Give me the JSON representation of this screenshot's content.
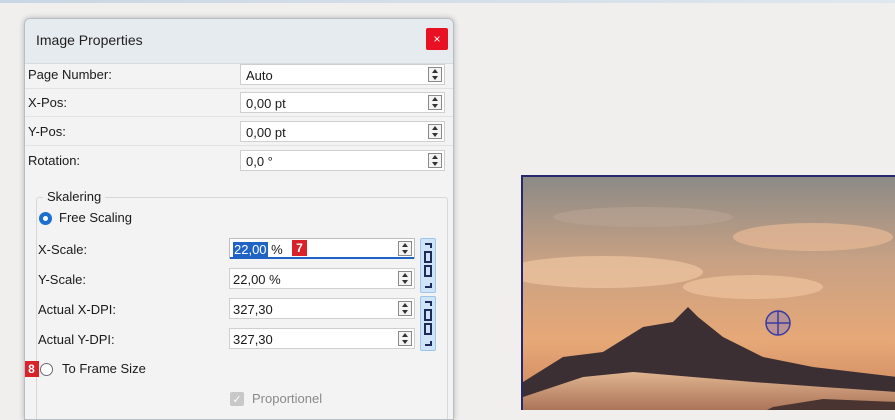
{
  "dialog": {
    "title": "Image Properties",
    "close_symbol": "×"
  },
  "fields": [
    {
      "label": "Page Number:",
      "value": "Auto"
    },
    {
      "label": "X-Pos:",
      "value": "0,00 pt"
    },
    {
      "label": "Y-Pos:",
      "value": "0,00 pt"
    },
    {
      "label": "Rotation:",
      "value": "0,0 °"
    }
  ],
  "scaling": {
    "group_label": "Skalering",
    "free_scaling_label": "Free Scaling",
    "x_scale_label": "X-Scale:",
    "x_scale_value": "22,00",
    "x_scale_unit": "%",
    "y_scale_label": "Y-Scale:",
    "y_scale_value": "22,00 %",
    "x_dpi_label": "Actual X-DPI:",
    "x_dpi_value": "327,30",
    "y_dpi_label": "Actual Y-DPI:",
    "y_dpi_value": "327,30",
    "to_frame_label": "To Frame Size",
    "proportional_label": "Proportionel",
    "free_scaling_selected": true,
    "to_frame_selected": false,
    "proportional_checked": true
  },
  "markers": [
    "7",
    "8"
  ],
  "colors": {
    "accent": "#1a6fd1",
    "close": "#e81123",
    "marker": "#d8232a",
    "frame_border": "#27276e"
  },
  "icons": [
    "close-icon",
    "spin-up-icon",
    "spin-down-icon",
    "chain-link-icon",
    "crosshair-icon",
    "checkmark-icon"
  ]
}
